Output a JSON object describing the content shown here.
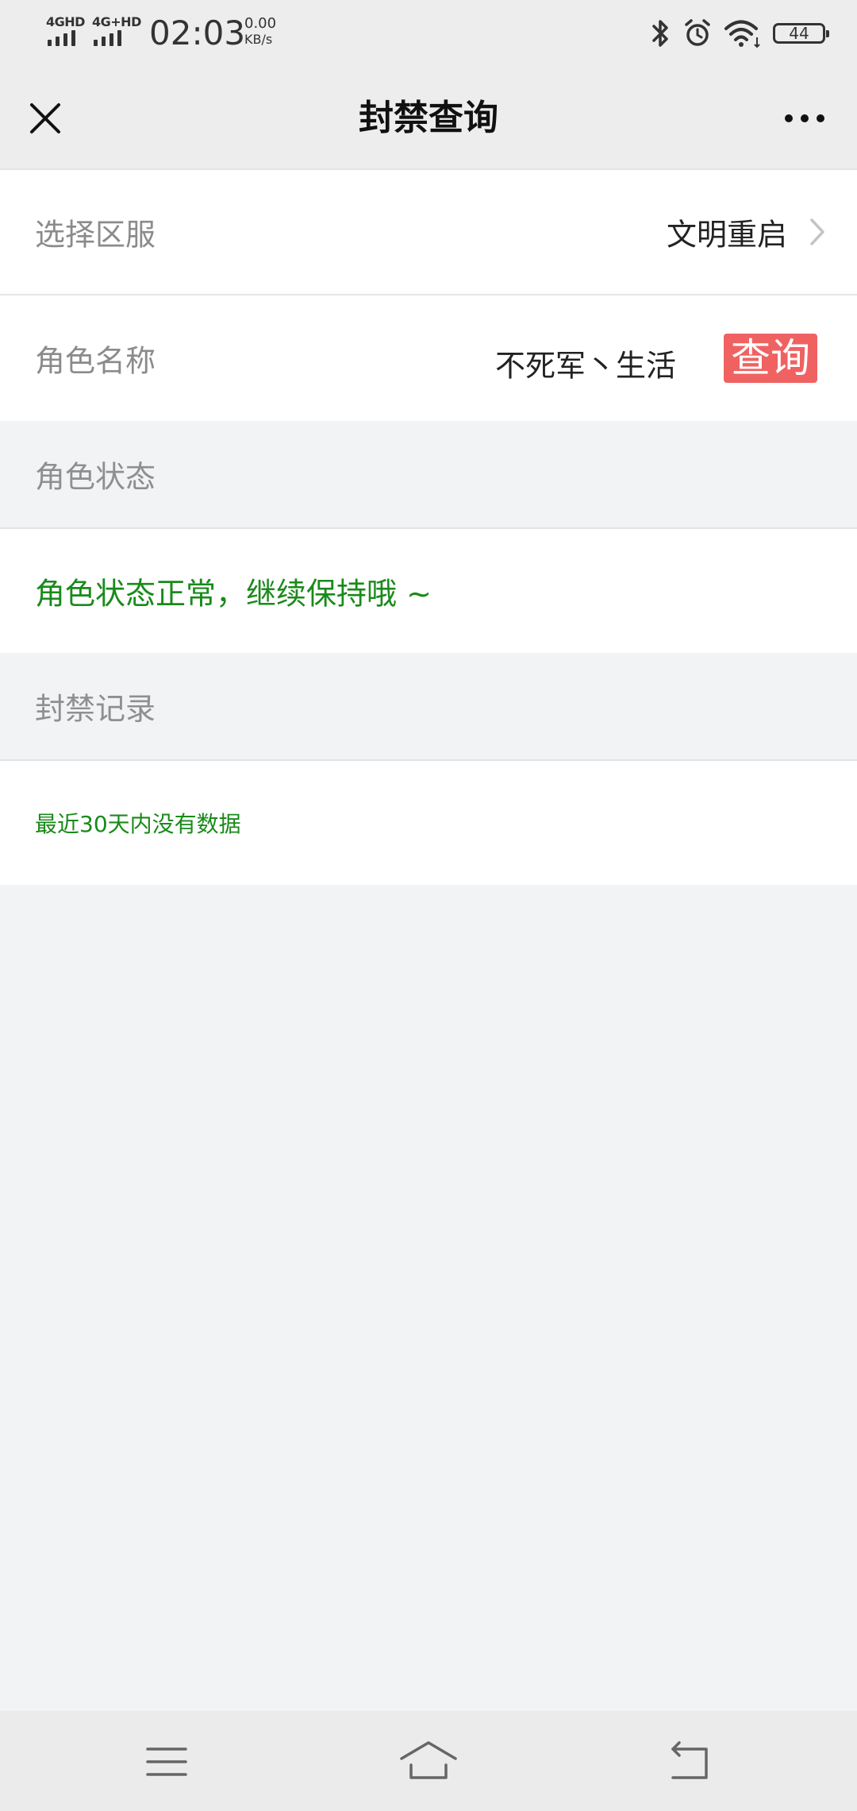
{
  "status_bar": {
    "net1": "4GHD",
    "net2": "4G+HD",
    "time": "02:03",
    "speed_value": "0.00",
    "speed_unit": "KB/s",
    "battery": "44",
    "icons": [
      "bluetooth-icon",
      "alarm-icon",
      "wifi-icon",
      "battery-icon"
    ]
  },
  "nav": {
    "title": "封禁查询",
    "close_icon": "close-icon",
    "more_icon": "more-icon"
  },
  "form": {
    "server_label": "选择区服",
    "server_value": "文明重启",
    "role_label": "角色名称",
    "role_value": "不死军丶生活",
    "query_button": "查询"
  },
  "status_section": {
    "header": "角色状态",
    "message": "角色状态正常，继续保持哦 ~"
  },
  "records_section": {
    "header": "封禁记录",
    "message": "最近30天内没有数据"
  },
  "system_nav": {
    "icons": [
      "menu-icon",
      "home-icon",
      "back-icon"
    ]
  },
  "colors": {
    "accent_red": "#f06262",
    "status_green": "#1a8a1a",
    "background": "#f2f3f5"
  }
}
